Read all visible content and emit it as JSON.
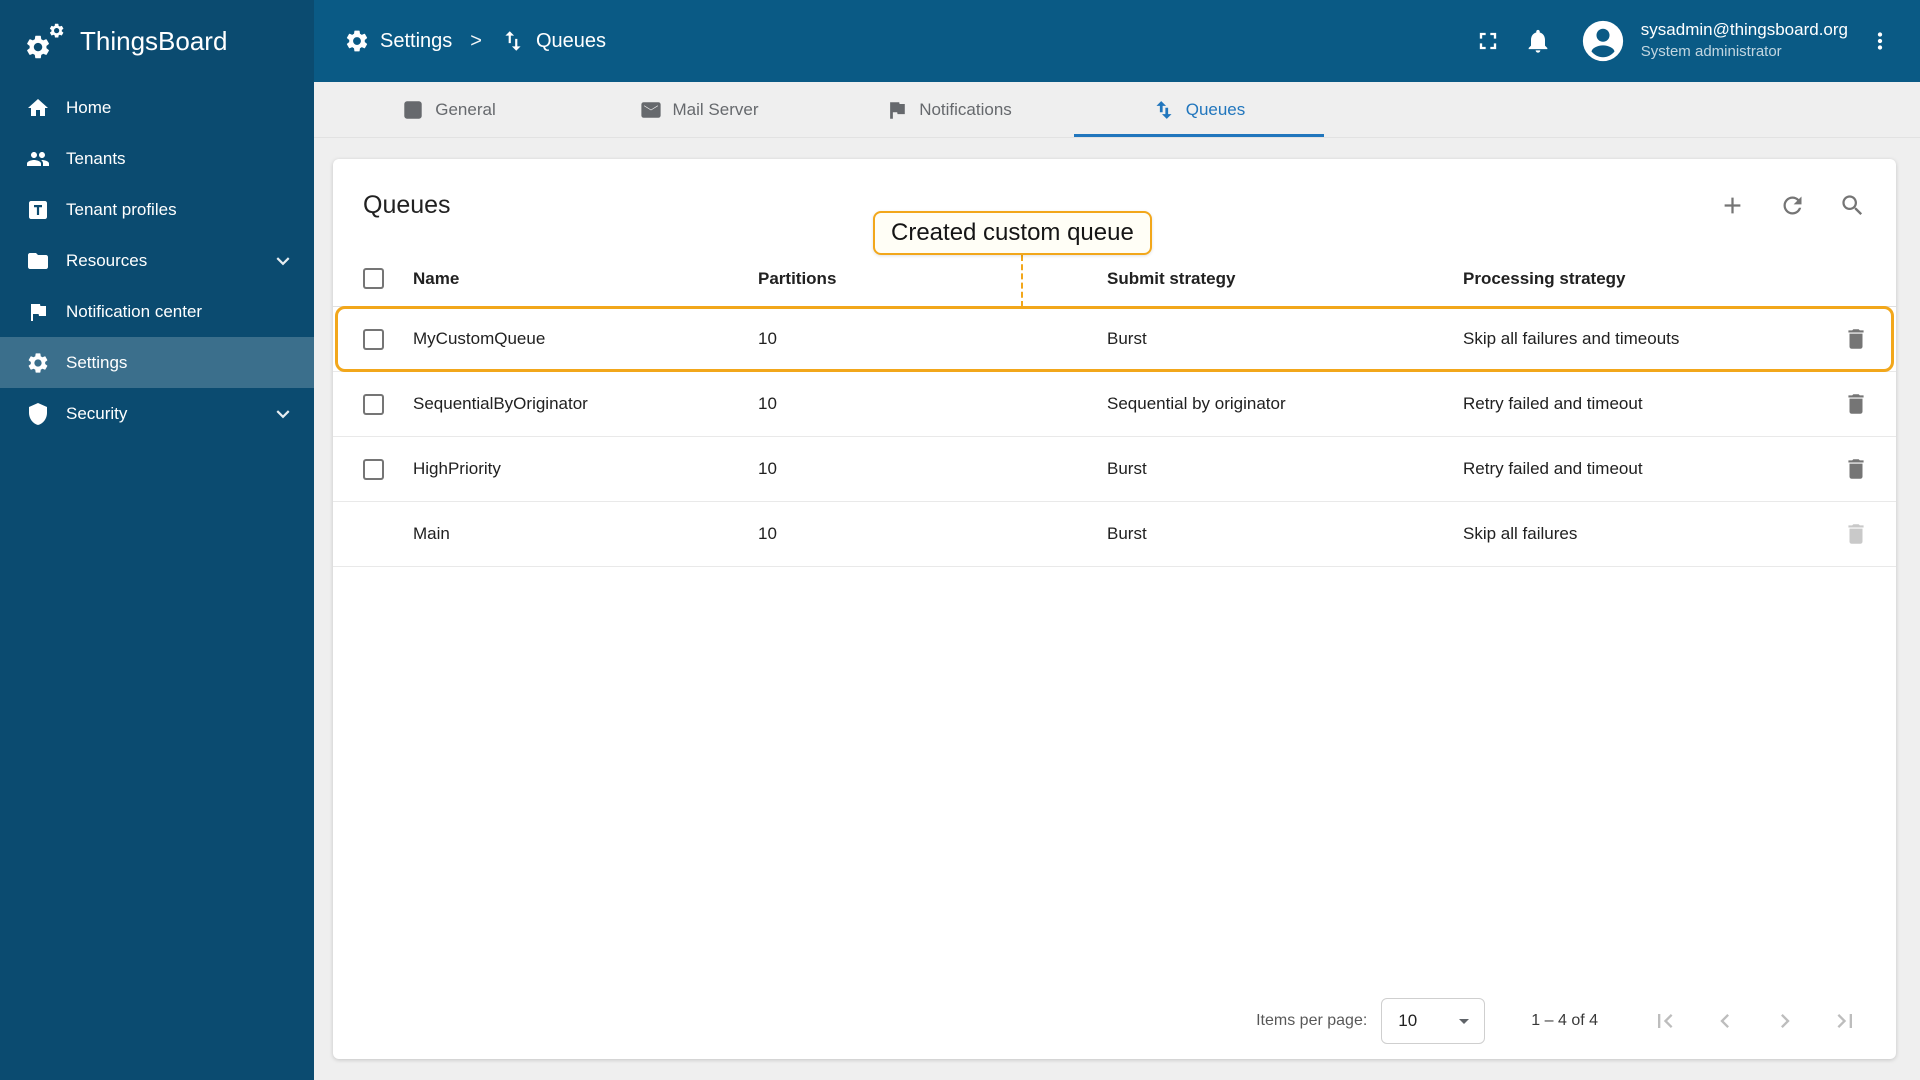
{
  "app": {
    "name": "ThingsBoard"
  },
  "colors": {
    "header-bg": "#0a5a85",
    "sidebar-bg": "#0b4b70",
    "accent": "#2176bd",
    "highlight": "#f2a71b"
  },
  "header": {
    "breadcrumb": [
      {
        "label": "Settings"
      },
      {
        "label": "Queues"
      }
    ],
    "breadcrumb_separator": ">",
    "user": {
      "email": "sysadmin@thingsboard.org",
      "role": "System administrator"
    },
    "icons": [
      "fullscreen-icon",
      "bell-icon",
      "account-circle-icon",
      "kebab-menu-icon"
    ]
  },
  "sidebar": {
    "items": [
      {
        "label": "Home",
        "icon": "home-icon"
      },
      {
        "label": "Tenants",
        "icon": "people-icon"
      },
      {
        "label": "Tenant profiles",
        "icon": "tenant-profile-box-icon"
      },
      {
        "label": "Resources",
        "icon": "folder-icon",
        "expandable": true
      },
      {
        "label": "Notification center",
        "icon": "flag-icon"
      },
      {
        "label": "Settings",
        "icon": "gear-icon",
        "active": true
      },
      {
        "label": "Security",
        "icon": "shield-icon",
        "expandable": true
      }
    ]
  },
  "tabs": [
    {
      "label": "General",
      "icon": "settings-square-icon"
    },
    {
      "label": "Mail Server",
      "icon": "mail-icon"
    },
    {
      "label": "Notifications",
      "icon": "flag-icon"
    },
    {
      "label": "Queues",
      "icon": "swap-vert-icon",
      "active": true
    }
  ],
  "queues": {
    "title": "Queues",
    "annotation": "Created custom queue",
    "toolbar_icons": [
      "add-icon",
      "refresh-icon",
      "search-icon"
    ],
    "columns": {
      "name": "Name",
      "partitions": "Partitions",
      "submit": "Submit strategy",
      "processing": "Processing strategy"
    },
    "rows": [
      {
        "name": "MyCustomQueue",
        "partitions": "10",
        "submit": "Burst",
        "processing": "Skip all failures and timeouts",
        "highlighted": true
      },
      {
        "name": "SequentialByOriginator",
        "partitions": "10",
        "submit": "Sequential by originator",
        "processing": "Retry failed and timeout"
      },
      {
        "name": "HighPriority",
        "partitions": "10",
        "submit": "Burst",
        "processing": "Retry failed and timeout"
      },
      {
        "name": "Main",
        "partitions": "10",
        "submit": "Burst",
        "processing": "Skip all failures",
        "system": true
      }
    ]
  },
  "pagination": {
    "items_per_page_label": "Items per page:",
    "items_per_page": "10",
    "range": "1 – 4 of 4"
  }
}
